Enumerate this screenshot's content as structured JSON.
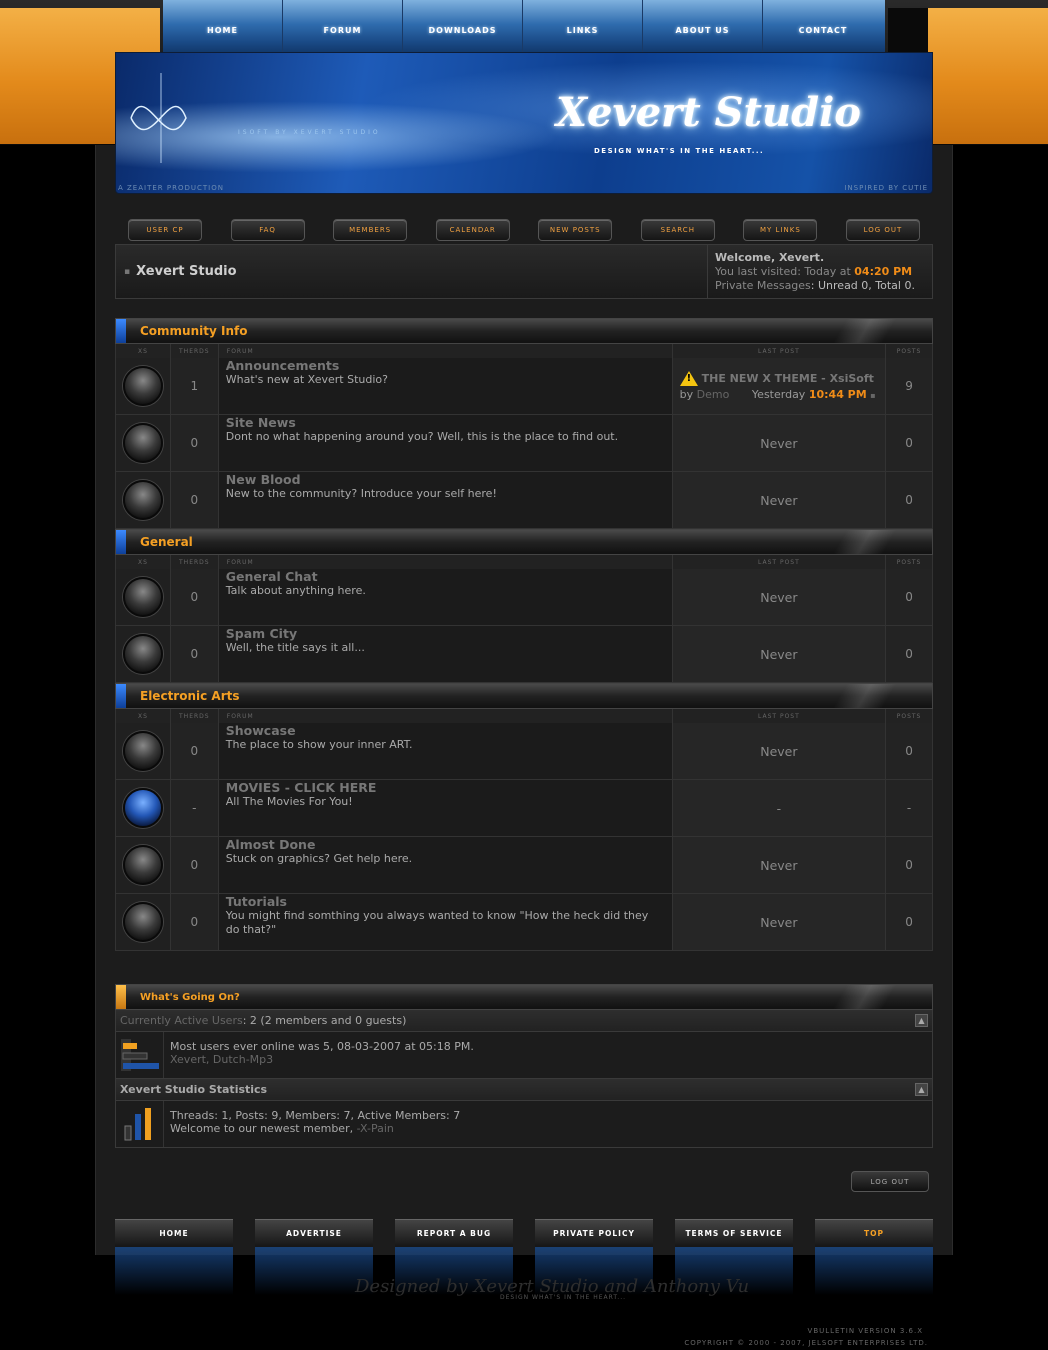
{
  "topnav": [
    "HOME",
    "FORUM",
    "DOWNLOADS",
    "LINKS",
    "ABOUT US",
    "CONTACT"
  ],
  "banner": {
    "title": "Xevert Studio",
    "tagline": "DESIGN WHAT'S IN THE HEART...",
    "small": "ISOFT BY XEVERT STUDIO",
    "production": "A ZEAITER PRODUCTION",
    "inspired": "INSPIRED BY CUTIE"
  },
  "buttons": [
    "USER CP",
    "FAQ",
    "MEMBERS",
    "CALENDAR",
    "NEW POSTS",
    "SEARCH",
    "MY LINKS",
    "LOG OUT"
  ],
  "navstrip": {
    "title": "Xevert Studio",
    "welcome": "Welcome, Xevert.",
    "visited_label": "You last visited: Today at",
    "visited_time": "04:20 PM",
    "pm_label": "Private Messages",
    "pm_value": ": Unread 0, Total 0."
  },
  "columns": {
    "xs": "XS",
    "threads": "THERDS",
    "forum": "FORUM",
    "last": "LAST POST",
    "posts": "POSTS"
  },
  "categories": [
    {
      "name": "Community Info",
      "forums": [
        {
          "title": "Announcements",
          "desc": "What's new at Xevert Studio?",
          "threads": "1",
          "posts": "9",
          "last": null
        },
        {
          "title": "Site News",
          "desc": "Dont no what happening around you? Well, this is the place to find out.",
          "threads": "0",
          "posts": "0",
          "last": "Never"
        },
        {
          "title": "New Blood",
          "desc": "New to the community? Introduce your self here!",
          "threads": "0",
          "posts": "0",
          "last": "Never"
        }
      ]
    },
    {
      "name": "General",
      "forums": [
        {
          "title": "General Chat",
          "desc": "Talk about anything here.",
          "threads": "0",
          "posts": "0",
          "last": "Never"
        },
        {
          "title": "Spam City",
          "desc": "Well, the title says it all...",
          "threads": "0",
          "posts": "0",
          "last": "Never"
        }
      ]
    },
    {
      "name": "Electronic Arts",
      "forums": [
        {
          "title": "Showcase",
          "desc": "The place to show your inner ART.",
          "threads": "0",
          "posts": "0",
          "last": "Never"
        },
        {
          "title": "MOVIES - CLICK HERE",
          "desc": "All The Movies For You!",
          "threads": "-",
          "posts": "-",
          "last": "-"
        },
        {
          "title": "Almost Done",
          "desc": "Stuck on graphics? Get help here.",
          "threads": "0",
          "posts": "0",
          "last": "Never"
        },
        {
          "title": "Tutorials",
          "desc": "You might find somthing you always wanted to know \"How the heck did they do that?\"",
          "threads": "0",
          "posts": "0",
          "last": "Never"
        }
      ]
    }
  ],
  "lastpost": {
    "title": "THE NEW X THEME - XsiSoft",
    "by": "by",
    "user": "Demo",
    "date": "Yesterday",
    "time": "10:44 PM"
  },
  "wgo": {
    "title": "What's Going On?",
    "active_label": "Currently Active Users",
    "active_value": ": 2 (2 members and 0 guests)",
    "most_online": "Most users ever online was 5, 08-03-2007 at 05:18 PM.",
    "users": "Xevert, Dutch-Mp3",
    "stats_label": "Xevert Studio Statistics",
    "stats": "Threads: 1, Posts: 9, Members: 7, Active Members: 7",
    "newest_label": "Welcome to our newest member,",
    "newest": "-X-Pain"
  },
  "logout_bottom": "LOG OUT",
  "footer": [
    "HOME",
    "ADVERTISE",
    "REPORT A BUG",
    "PRIVATE POLICY",
    "TERMS OF SERVICE",
    "TOP"
  ],
  "designed": "Designed by Xevert Studio and Anthony Vu",
  "designed_sub": "DESIGN WHAT'S IN THE HEART...",
  "vb": "VBULLETIN VERSION 3.6.X",
  "copyright": "COPYRIGHT © 2000 - 2007, JELSOFT ENTERPRISES LTD."
}
